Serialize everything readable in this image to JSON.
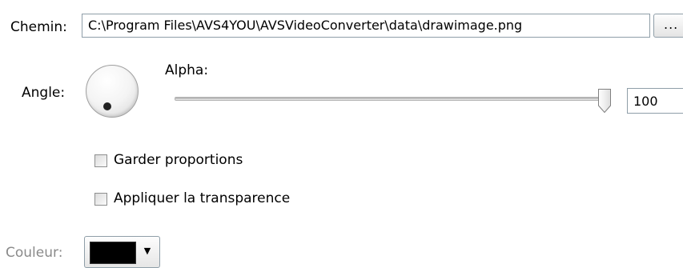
{
  "path": {
    "label": "Chemin:",
    "value": "C:\\Program Files\\AVS4YOU\\AVSVideoConverter\\data\\drawimage.png",
    "browse_label": "..."
  },
  "angle": {
    "label": "Angle:"
  },
  "alpha": {
    "label": "Alpha:",
    "value": "100",
    "fraction": 1.0
  },
  "options": {
    "keep_proportions": {
      "label": "Garder proportions",
      "checked": false
    },
    "apply_transparency": {
      "label": "Appliquer la transparence",
      "checked": false
    }
  },
  "color": {
    "label": "Couleur:",
    "value": "#000000",
    "arrow_icon": "chevron-down-icon"
  }
}
